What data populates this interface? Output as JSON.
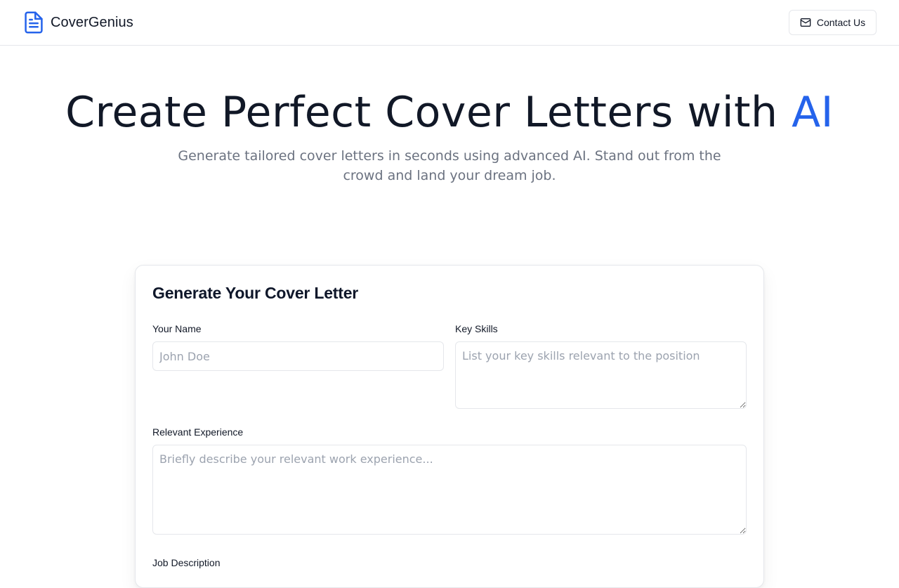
{
  "header": {
    "brand_name": "CoverGenius",
    "contact_label": "Contact Us"
  },
  "hero": {
    "title_main": "Create Perfect Cover Letters with ",
    "title_accent": "AI",
    "subtitle": "Generate tailored cover letters in seconds using advanced AI. Stand out from the crowd and land your dream job."
  },
  "form": {
    "title": "Generate Your Cover Letter",
    "name": {
      "label": "Your Name",
      "placeholder": "John Doe",
      "value": ""
    },
    "skills": {
      "label": "Key Skills",
      "placeholder": "List your key skills relevant to the position",
      "value": ""
    },
    "experience": {
      "label": "Relevant Experience",
      "placeholder": "Briefly describe your relevant work experience...",
      "value": ""
    },
    "job_description": {
      "label": "Job Description"
    }
  },
  "colors": {
    "accent": "#2563eb",
    "text": "#111827",
    "muted": "#6b7280",
    "border": "#e5e7eb"
  },
  "icons": {
    "brand": "file-text-icon",
    "contact": "mail-icon"
  }
}
